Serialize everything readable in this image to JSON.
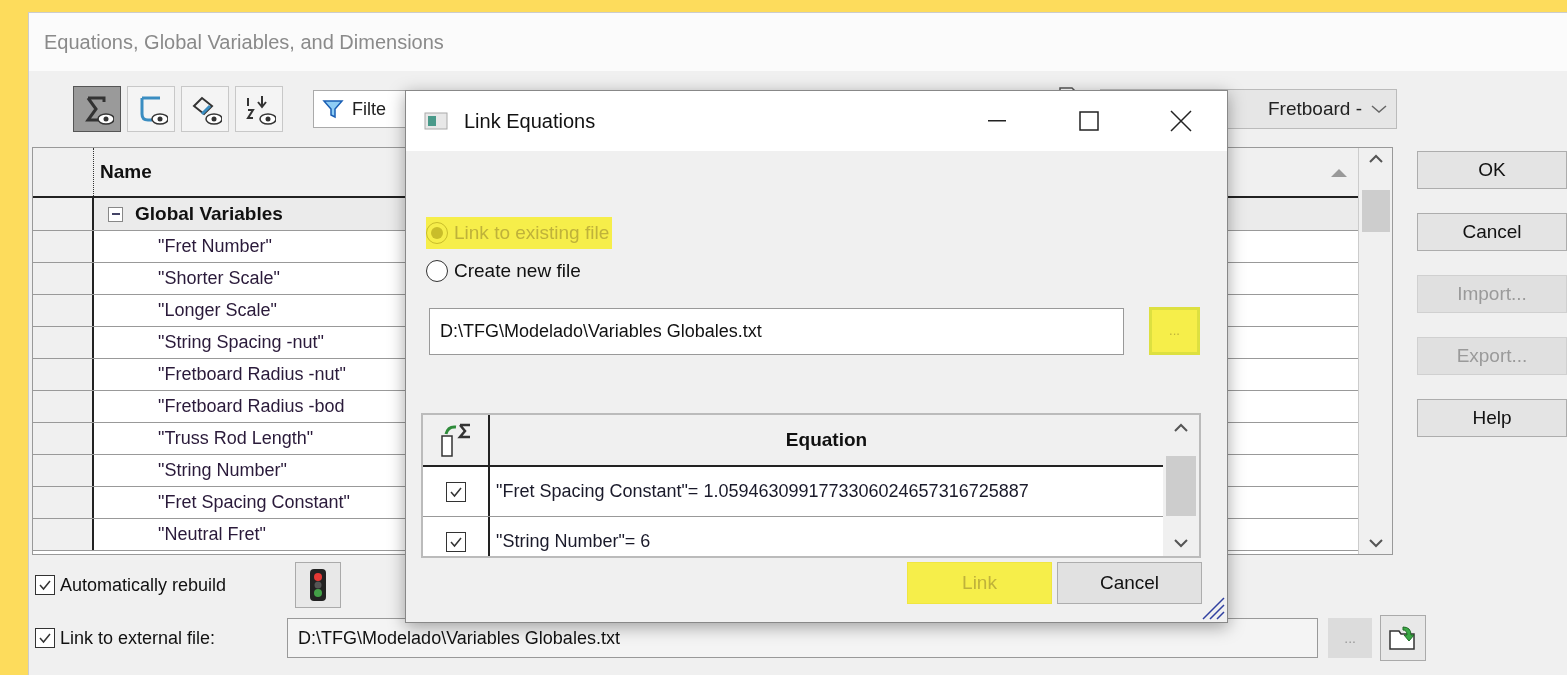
{
  "window": {
    "title": "Equations, Global Variables, and Dimensions"
  },
  "toolbar": {
    "view_buttons": [
      {
        "kind": "sigma",
        "selected": true
      },
      {
        "kind": "sketch",
        "selected": false
      },
      {
        "kind": "dimension",
        "selected": false
      },
      {
        "kind": "order",
        "selected": false
      }
    ],
    "filter": {
      "value": "Filte"
    },
    "config": {
      "value": "Fretboard -"
    }
  },
  "table": {
    "columns": [
      "Name"
    ],
    "group": {
      "name": "Global Variables",
      "expanded": true
    },
    "rows": [
      "\"Fret Number\"",
      "\"Shorter Scale\"",
      "\"Longer Scale\"",
      "\"String Spacing -nut\"",
      "\"Fretboard Radius -nut\"",
      "\"Fretboard Radius -bod",
      "\"Truss Rod Length\"",
      "\"String Number\"",
      "\"Fret Spacing Constant\"",
      "\"Neutral Fret\""
    ]
  },
  "buttons": [
    {
      "label": "OK",
      "disabled": false
    },
    {
      "label": "Cancel",
      "disabled": false
    },
    {
      "label": "Import...",
      "disabled": true
    },
    {
      "label": "Export...",
      "disabled": true
    },
    {
      "label": "Help",
      "disabled": false
    }
  ],
  "rebuild": {
    "label": "Automatically rebuild",
    "checked": true
  },
  "external_link": {
    "label": "Link to external file:",
    "checked": true,
    "path": "D:\\TFG\\Modelado\\Variables Globales.txt",
    "browse": {
      "label": "...",
      "disabled": true
    }
  },
  "dialog": {
    "title": "Link Equations",
    "options": [
      {
        "label": "Link to existing file",
        "selected": true,
        "disabled": true,
        "highlighted": true
      },
      {
        "label": "Create new file",
        "selected": false,
        "disabled": false,
        "highlighted": false
      }
    ],
    "path": "D:\\TFG\\Modelado\\Variables Globales.txt",
    "browse": {
      "label": "...",
      "disabled": true,
      "highlighted": true
    },
    "columns": [
      "Equation"
    ],
    "equations": [
      {
        "text": "\"Fret Spacing Constant\"= 1.0594630991773306024657316725887",
        "checked": true
      },
      {
        "text": "\"String Number\"= 6",
        "checked": true
      }
    ],
    "buttons": [
      {
        "label": "Link",
        "disabled": true,
        "highlighted": true
      },
      {
        "label": "Cancel",
        "disabled": false,
        "highlighted": false
      }
    ]
  }
}
